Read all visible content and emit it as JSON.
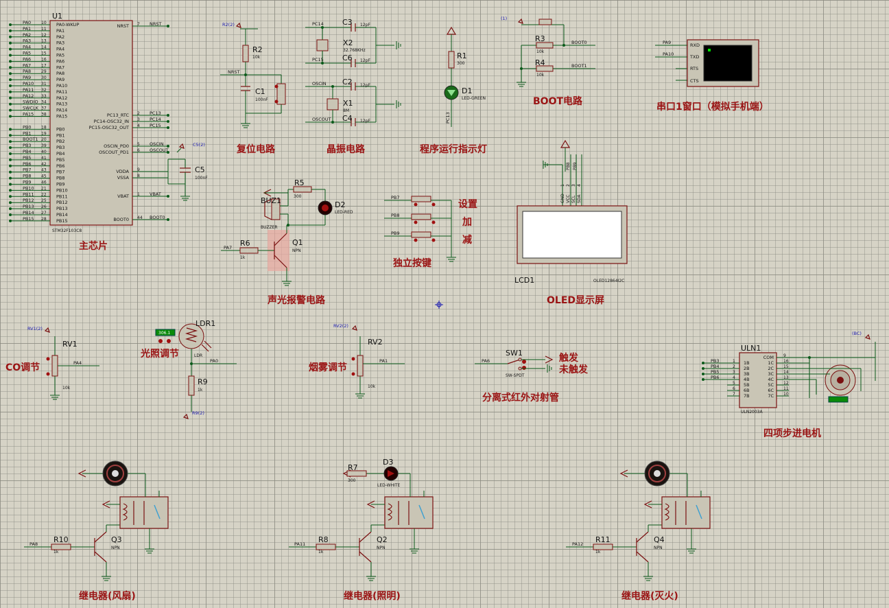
{
  "mcu": {
    "ref": "U1",
    "part": "STM32F103C8",
    "left_pins": [
      {
        "name": "PA0",
        "num": "10",
        "pin": "PA0-WKUP"
      },
      {
        "name": "PA1",
        "num": "11",
        "pin": "PA1"
      },
      {
        "name": "PA2",
        "num": "12",
        "pin": "PA2"
      },
      {
        "name": "PA3",
        "num": "13",
        "pin": "PA3"
      },
      {
        "name": "PA4",
        "num": "14",
        "pin": "PA4"
      },
      {
        "name": "PA5",
        "num": "15",
        "pin": "PA5"
      },
      {
        "name": "PA6",
        "num": "16",
        "pin": "PA6"
      },
      {
        "name": "PA7",
        "num": "17",
        "pin": "PA7"
      },
      {
        "name": "PA8",
        "num": "29",
        "pin": "PA8"
      },
      {
        "name": "PA9",
        "num": "30",
        "pin": "PA9"
      },
      {
        "name": "PA10",
        "num": "31",
        "pin": "PA10"
      },
      {
        "name": "PA11",
        "num": "32",
        "pin": "PA11"
      },
      {
        "name": "PA12",
        "num": "33",
        "pin": "PA12"
      },
      {
        "name": "SWDIO",
        "num": "34",
        "pin": "PA13"
      },
      {
        "name": "SWCLK",
        "num": "37",
        "pin": "PA14"
      },
      {
        "name": "PA15",
        "num": "38",
        "pin": "PA15"
      },
      {
        "name": "PB0",
        "num": "18",
        "pin": "PB0"
      },
      {
        "name": "PB1",
        "num": "19",
        "pin": "PB1"
      },
      {
        "name": "BOOT1",
        "num": "20",
        "pin": "PB2"
      },
      {
        "name": "PB3",
        "num": "39",
        "pin": "PB3"
      },
      {
        "name": "PB4",
        "num": "40",
        "pin": "PB4"
      },
      {
        "name": "PB5",
        "num": "41",
        "pin": "PB5"
      },
      {
        "name": "PB6",
        "num": "42",
        "pin": "PB6"
      },
      {
        "name": "PB7",
        "num": "43",
        "pin": "PB7"
      },
      {
        "name": "PB8",
        "num": "45",
        "pin": "PB8"
      },
      {
        "name": "PB9",
        "num": "46",
        "pin": "PB9"
      },
      {
        "name": "PB10",
        "num": "21",
        "pin": "PB10"
      },
      {
        "name": "PB11",
        "num": "22",
        "pin": "PB11"
      },
      {
        "name": "PB12",
        "num": "25",
        "pin": "PB12"
      },
      {
        "name": "PB13",
        "num": "26",
        "pin": "PB13"
      },
      {
        "name": "PB14",
        "num": "27",
        "pin": "PB14"
      },
      {
        "name": "PB15",
        "num": "28",
        "pin": "PB15"
      }
    ],
    "right_pins": [
      {
        "pin": "NRST",
        "num": "7",
        "net": "NRST"
      },
      {
        "pin": "PC13_RTC",
        "num": "2",
        "net": "PC13"
      },
      {
        "pin": "PC14-OSC32_IN",
        "num": "3",
        "net": "PC14"
      },
      {
        "pin": "PC15-OSC32_OUT",
        "num": "4",
        "net": "PC15"
      },
      {
        "pin": "OSCIN_PD0",
        "num": "5",
        "net": "OSCIN"
      },
      {
        "pin": "OSCOUT_PD1",
        "num": "6",
        "net": "OSCOUT"
      },
      {
        "pin": "VDDA",
        "num": "9",
        "net": ""
      },
      {
        "pin": "VSSA",
        "num": "8",
        "net": ""
      },
      {
        "pin": "VBAT",
        "num": "1",
        "net": "VBAT"
      },
      {
        "pin": "BOOT0",
        "num": "44",
        "net": "BOOT0"
      }
    ]
  },
  "titles": {
    "main_chip": "主芯片",
    "reset": "复位电路",
    "crystal": "晶振电路",
    "indicator": "程序运行指示灯",
    "boot": "BOOT电路",
    "uart": "串口1窗口（模拟手机端）",
    "alarm": "声光报警电路",
    "keys": "独立按键",
    "oled": "OLED显示屏",
    "co": "CO调节",
    "light": "光照调节",
    "smoke": "烟雾调节",
    "ir": "分离式红外对射管",
    "stepper": "四项步进电机",
    "relay_fan": "继电器(风扇)",
    "relay_light": "继电器(照明)",
    "relay_fire": "继电器(灭火)"
  },
  "key_labels": {
    "set": "设置",
    "up": "加",
    "down": "减"
  },
  "ir_labels": {
    "trigger": "触发",
    "no_trigger": "未触发"
  },
  "parts": {
    "r2": {
      "ref": "R2",
      "val": "10k"
    },
    "c1": {
      "ref": "C1",
      "val": "100nF"
    },
    "c3": {
      "ref": "C3",
      "val": "12pF"
    },
    "c6": {
      "ref": "C6",
      "val": "12pF"
    },
    "x2": {
      "ref": "X2",
      "val": "32.768KHz"
    },
    "c2": {
      "ref": "C2",
      "val": "12pF"
    },
    "c4": {
      "ref": "C4",
      "val": "12pF"
    },
    "x1": {
      "ref": "X1",
      "val": "8M"
    },
    "r1": {
      "ref": "R1",
      "val": "300"
    },
    "d1": {
      "ref": "D1",
      "val": "LED-GREEN"
    },
    "r3": {
      "ref": "R3",
      "val": "10k"
    },
    "r4": {
      "ref": "R4",
      "val": "10k"
    },
    "c5": {
      "ref": "C5",
      "val": "100nF"
    },
    "r5": {
      "ref": "R5",
      "val": "300"
    },
    "d2": {
      "ref": "D2",
      "val": "LED-RED"
    },
    "buz1": {
      "ref": "BUZ1",
      "val": "BUZZER"
    },
    "r6": {
      "ref": "R6",
      "val": "1k"
    },
    "q1": {
      "ref": "Q1",
      "val": "NPN"
    },
    "lcd1": {
      "ref": "LCD1",
      "val": "OLED12864I2C"
    },
    "rv1": {
      "ref": "RV1",
      "val": "10k"
    },
    "ldr1": {
      "ref": "LDR1",
      "val": "LDR",
      "reading": "306.1"
    },
    "r9": {
      "ref": "R9",
      "val": "1k"
    },
    "rv2": {
      "ref": "RV2",
      "val": "10k"
    },
    "sw1": {
      "ref": "SW1",
      "val": "SW-SPDT"
    },
    "uln1": {
      "ref": "ULN1",
      "val": "ULN2003A"
    },
    "r10": {
      "ref": "R10",
      "val": "1k"
    },
    "q3": {
      "ref": "Q3",
      "val": "NPN"
    },
    "r7": {
      "ref": "R7",
      "val": "300"
    },
    "d3": {
      "ref": "D3",
      "val": "LED-WHITE"
    },
    "r8": {
      "ref": "R8",
      "val": "1k"
    },
    "q2": {
      "ref": "Q2",
      "val": "NPN"
    },
    "r11": {
      "ref": "R11",
      "val": "1k"
    },
    "q4": {
      "ref": "Q4",
      "val": "NPN"
    }
  },
  "nets": {
    "nrst": "NRST",
    "pc14": "PC14",
    "pc15": "PC15",
    "oscin": "OSCIN",
    "oscout": "OSCOUT",
    "pc13": "PC13",
    "boot0": "BOOT0",
    "boot1": "BOOT1",
    "pa9": "PA9",
    "pa10": "PA10",
    "pa7": "PA7",
    "pb7": "PB7",
    "pb8": "PB8",
    "pb9": "PB9",
    "pa4": "PA4",
    "pa0": "PA0",
    "pa1": "PA1",
    "pa6": "PA6",
    "pa8": "PA8",
    "pa11": "PA11",
    "pa12": "PA12",
    "pb3": "PB3",
    "pb4": "PB4",
    "pb5": "PB5",
    "pb6": "PB6"
  },
  "probes": {
    "r2": "R2(2)",
    "c5": "C5(2)",
    "boot": "(1)",
    "rv1": "RV1(2)",
    "rv2": "RV2(2)",
    "r9": "R9(2)",
    "bc": "(BC)"
  },
  "terminal": {
    "rxd": "RXD",
    "txd": "TXD",
    "rts": "RTS",
    "cts": "CTS"
  },
  "oled_pins": [
    "GND",
    "VCC",
    "SCL",
    "SDA"
  ],
  "oled_pin_nums": [
    "1",
    "2",
    "3",
    "4"
  ],
  "oled_nets": [
    "PB8",
    "PB9"
  ],
  "uln": {
    "in_pins": [
      "1B",
      "2B",
      "3B",
      "4B",
      "5B",
      "6B",
      "7B"
    ],
    "in_nums": [
      "1",
      "2",
      "3",
      "4",
      "5",
      "6",
      "7"
    ],
    "out_pins": [
      "COM",
      "1C",
      "2C",
      "3C",
      "4C",
      "5C",
      "6C",
      "7C"
    ],
    "out_nums": [
      "9",
      "16",
      "15",
      "14",
      "13",
      "12",
      "11",
      "10"
    ]
  },
  "colors": {
    "wire": "#0a5a1a",
    "component": "#7a1010",
    "title": "#9a1414",
    "grid_bg": "#d6d3c6"
  }
}
